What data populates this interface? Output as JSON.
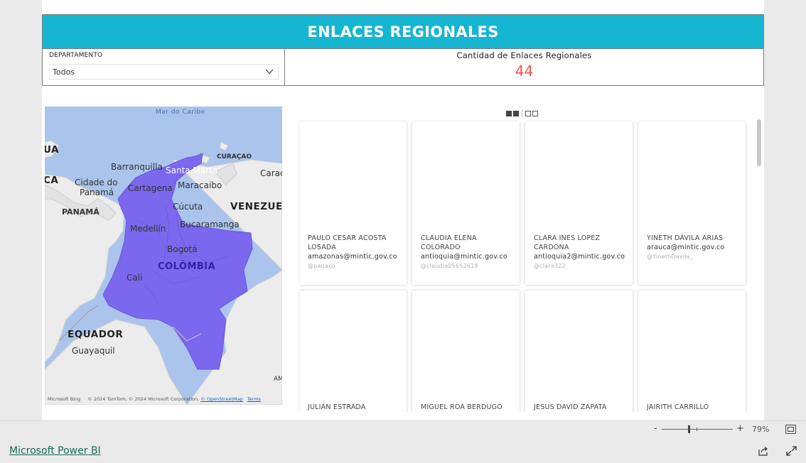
{
  "header": {
    "title": "ENLACES REGIONALES"
  },
  "filter": {
    "label": "DEPARTAMENTO",
    "value": "Todos"
  },
  "card": {
    "title": "Cantidad de Enlaces Regionales",
    "value": "44"
  },
  "map": {
    "labels": {
      "sea": "Mar do Caribe",
      "ua": "UA",
      "ca": "CA",
      "barranquilla": "Barranquilla",
      "santa_marta": "Santa Marta",
      "curacao": "CURAÇAO",
      "carac": "Carac",
      "cidade_do": "Cidade do",
      "panama_city": "Panamá",
      "cartagena": "Cartagena",
      "maracaibo": "Maracaibo",
      "panama": "PANAMÁ",
      "cucuta": "Cúcuta",
      "venezuela": "VENEZUEL",
      "medellin": "Medellín",
      "bucaramanga": "Bucaramanga",
      "bogota": "Bogotá",
      "colombia": "COLÔMBIA",
      "cali": "Cali",
      "equador": "EQUADOR",
      "guayaquil": "Guayaquil",
      "am": "AM"
    },
    "footer": {
      "brand": "Microsoft Bing",
      "copyright": "© 2024 TomTom, © 2024 Microsoft Corporation,",
      "osm": "© OpenStreetMap",
      "terms": "Terms"
    },
    "colors": {
      "country": "#7b68ee",
      "sea": "#aac4ec",
      "land": "#ececec"
    }
  },
  "people": [
    {
      "name": "PAULO CESAR ACOSTA LOSADA",
      "email": "amazonas@mintic.gov.co",
      "handle": "@pauaco"
    },
    {
      "name": "CLAUDIA ELENA COLORADO",
      "email": "antioquia@mintic.gov.co",
      "handle": "@claudia05652618"
    },
    {
      "name": "CLARA INES LOPEZ CARDONA",
      "email": "antioquia2@mintic.gov.co",
      "handle": "@clara322"
    },
    {
      "name": "YINETH DÁVILA ARIAS",
      "email": "arauca@mintic.gov.co",
      "handle": "@YinethDavila_"
    },
    {
      "name": "JULIÁN ESTRADA",
      "email": "",
      "handle": ""
    },
    {
      "name": "MIGUEL ROA BERDUGO",
      "email": "",
      "handle": ""
    },
    {
      "name": "JESUS DAVID ZAPATA",
      "email": "",
      "handle": ""
    },
    {
      "name": "JAIRITH CARRILLO",
      "email": "",
      "handle": ""
    }
  ],
  "zoom": {
    "minus": "-",
    "plus": "+",
    "percent": "79%",
    "level": 0.79
  },
  "footer": {
    "brand": "Microsoft Power BI"
  },
  "colors": {
    "header": "#16b5d2",
    "card_value": "#f2544b"
  },
  "icons": [
    "chevron-down-icon",
    "fit-to-page-icon",
    "share-icon",
    "expand-icon"
  ]
}
